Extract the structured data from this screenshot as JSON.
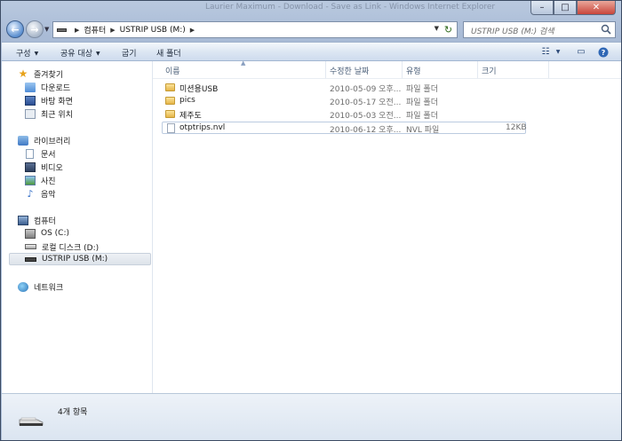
{
  "window": {
    "title": "Laurier Maximum - Download - Save as Link - Windows Internet Explorer"
  },
  "address": {
    "root": "컴퓨터",
    "drive": "USTRIP USB (M:)"
  },
  "search": {
    "placeholder": "USTRIP USB (M:) 검색"
  },
  "toolbar": {
    "organize": "구성",
    "share": "공유 대상",
    "burn": "굽기",
    "new_folder": "새 폴더"
  },
  "sidebar": {
    "favorites": "즐겨찾기",
    "favorites_items": [
      "다운로드",
      "바탕 화면",
      "최근 위치"
    ],
    "libraries": "라이브러리",
    "library_items": [
      "문서",
      "비디오",
      "사진",
      "음악"
    ],
    "computer": "컴퓨터",
    "computer_items": [
      "OS (C:)",
      "로컬 디스크 (D:)",
      "USTRIP USB (M:)"
    ],
    "network": "네트워크"
  },
  "columns": {
    "name": "이름",
    "modified": "수정한 날짜",
    "type": "유형",
    "size": "크기"
  },
  "files": [
    {
      "name": "미션용USB",
      "modified": "2010-05-09 오후...",
      "type": "파일 폴더",
      "size": "",
      "kind": "folder"
    },
    {
      "name": "pics",
      "modified": "2010-05-17 오전...",
      "type": "파일 폴더",
      "size": "",
      "kind": "folder"
    },
    {
      "name": "제주도",
      "modified": "2010-05-03 오전...",
      "type": "파일 폴더",
      "size": "",
      "kind": "folder"
    },
    {
      "name": "otptrips.nvl",
      "modified": "2010-06-12 오후...",
      "type": "NVL 파일",
      "size": "12KB",
      "kind": "file"
    }
  ],
  "status": {
    "item_count": "4개 항목"
  }
}
